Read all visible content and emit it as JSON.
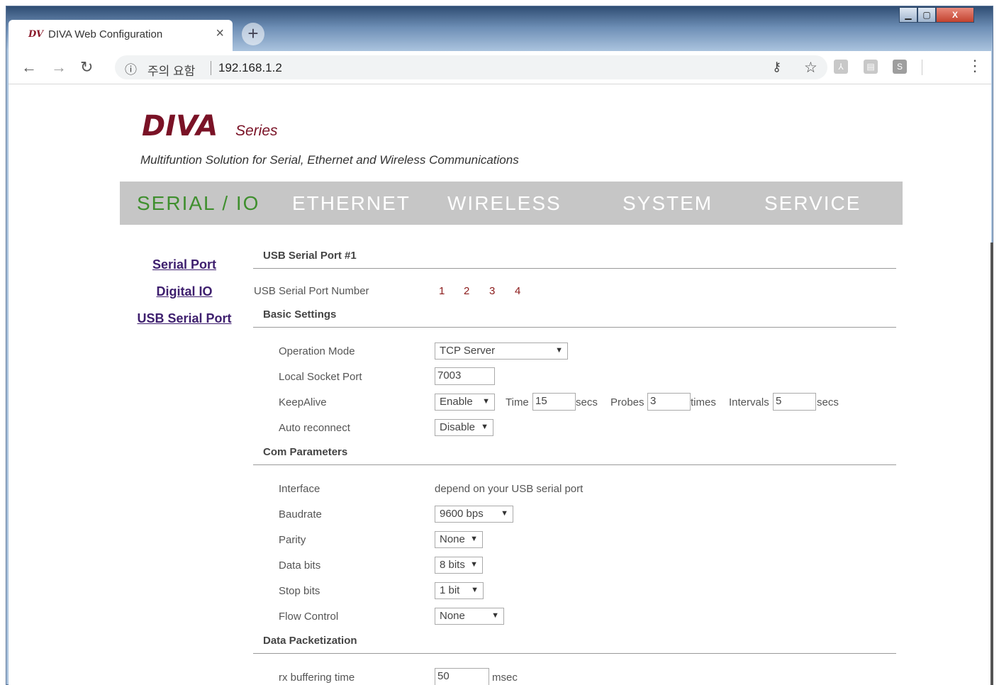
{
  "browser": {
    "tab_title": "DIVA Web Configuration",
    "tab_favicon": "DV",
    "tab_close": "×",
    "new_tab": "+",
    "security_label": "주의 요함",
    "url": "192.168.1.2",
    "window_buttons": [
      "▁",
      "▢",
      "X"
    ]
  },
  "header": {
    "logo": "DIVA",
    "logo_sub": "Series",
    "tagline": "Multifuntion Solution for Serial, Ethernet and Wireless Communications"
  },
  "mainnav": {
    "items": [
      "SERIAL / IO",
      "ETHERNET",
      "WIRELESS",
      "SYSTEM",
      "SERVICE"
    ],
    "active": "SERIAL / IO",
    "active_color": "#3f8f2e"
  },
  "sidebar": {
    "links": [
      "Serial Port",
      "Digital IO",
      "USB Serial Port"
    ]
  },
  "content": {
    "title": "USB Serial Port #1",
    "port_number_label": "USB Serial Port Number",
    "port_numbers": [
      "1",
      "2",
      "3",
      "4"
    ],
    "basic": {
      "title": "Basic Settings",
      "operation_mode_label": "Operation Mode",
      "operation_mode": "TCP Server",
      "local_socket_port_label": "Local Socket Port",
      "local_socket_port": "7003",
      "keepalive_label": "KeepAlive",
      "keepalive": "Enable",
      "time_label": "Time",
      "time_value": "15",
      "secs_label": "secs",
      "probes_label": "Probes",
      "probes_value": "3",
      "times_label": "times",
      "intervals_label": "Intervals",
      "intervals_value": "5",
      "auto_reconnect_label": "Auto reconnect",
      "auto_reconnect": "Disable"
    },
    "com": {
      "title": "Com Parameters",
      "interface_label": "Interface",
      "interface_value": "depend on your USB serial port",
      "baudrate_label": "Baudrate",
      "baudrate": "9600 bps",
      "parity_label": "Parity",
      "parity": "None",
      "data_bits_label": "Data bits",
      "data_bits": "8 bits",
      "stop_bits_label": "Stop bits",
      "stop_bits": "1 bit",
      "flow_control_label": "Flow Control",
      "flow_control": "None"
    },
    "packet": {
      "title": "Data Packetization",
      "rx_buffering_label": "rx buffering time",
      "rx_buffering_value": "50",
      "msec_label": "msec"
    }
  }
}
